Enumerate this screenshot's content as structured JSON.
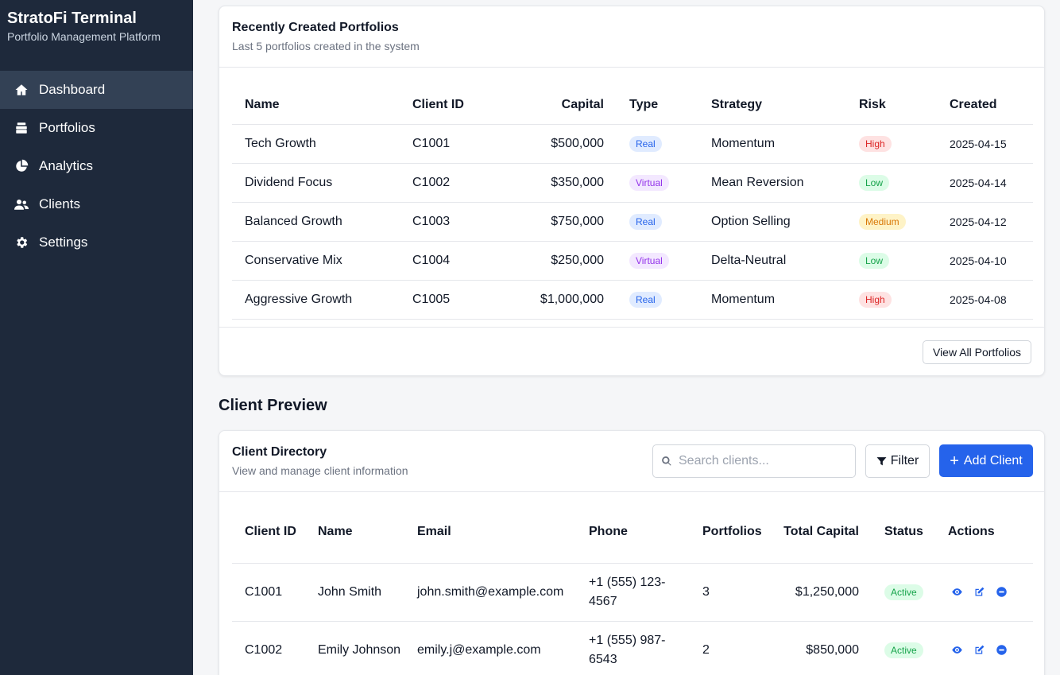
{
  "brand": {
    "title": "StratoFi Terminal",
    "subtitle": "Portfolio Management Platform"
  },
  "nav": [
    {
      "label": "Dashboard",
      "icon": "home-icon",
      "active": true
    },
    {
      "label": "Portfolios",
      "icon": "layers-icon"
    },
    {
      "label": "Analytics",
      "icon": "pie-chart-icon"
    },
    {
      "label": "Clients",
      "icon": "users-icon"
    },
    {
      "label": "Settings",
      "icon": "gear-icon"
    }
  ],
  "recent": {
    "title": "Recently Created Portfolios",
    "subtitle": "Last 5 portfolios created in the system",
    "headers": [
      "Name",
      "Client ID",
      "Capital",
      "Type",
      "Strategy",
      "Risk",
      "Created"
    ],
    "rows": [
      {
        "name": "Tech Growth",
        "client": "C1001",
        "capital": "$500,000",
        "type": "Real",
        "strategy": "Momentum",
        "risk": "High",
        "created": "2025-04-15"
      },
      {
        "name": "Dividend Focus",
        "client": "C1002",
        "capital": "$350,000",
        "type": "Virtual",
        "strategy": "Mean Reversion",
        "risk": "Low",
        "created": "2025-04-14"
      },
      {
        "name": "Balanced Growth",
        "client": "C1003",
        "capital": "$750,000",
        "type": "Real",
        "strategy": "Option Selling",
        "risk": "Medium",
        "created": "2025-04-12"
      },
      {
        "name": "Conservative Mix",
        "client": "C1004",
        "capital": "$250,000",
        "type": "Virtual",
        "strategy": "Delta-Neutral",
        "risk": "Low",
        "created": "2025-04-10"
      },
      {
        "name": "Aggressive Growth",
        "client": "C1005",
        "capital": "$1,000,000",
        "type": "Real",
        "strategy": "Momentum",
        "risk": "High",
        "created": "2025-04-08"
      }
    ],
    "view_all_label": "View All Portfolios"
  },
  "client_preview": {
    "section_title": "Client Preview",
    "title": "Client Directory",
    "subtitle": "View and manage client information",
    "search_placeholder": "Search clients...",
    "filter_label": "Filter",
    "add_label": "Add Client",
    "headers": {
      "id": "Client ID",
      "name": "Name",
      "email": "Email",
      "phone": "Phone",
      "portfolios": "Portfolios",
      "capital": "Total Capital",
      "status": "Status",
      "actions": "Actions"
    },
    "rows": [
      {
        "id": "C1001",
        "name": "John Smith",
        "email": "john.smith@example.com",
        "phone": "+1 (555) 123-4567",
        "portfolios": "3",
        "capital": "$1,250,000",
        "status": "Active"
      },
      {
        "id": "C1002",
        "name": "Emily Johnson",
        "email": "emily.j@example.com",
        "phone": "+1 (555) 987-6543",
        "portfolios": "2",
        "capital": "$850,000",
        "status": "Active"
      }
    ]
  },
  "colors": {
    "sidebar": "#1e293b",
    "accent": "#2563eb"
  }
}
